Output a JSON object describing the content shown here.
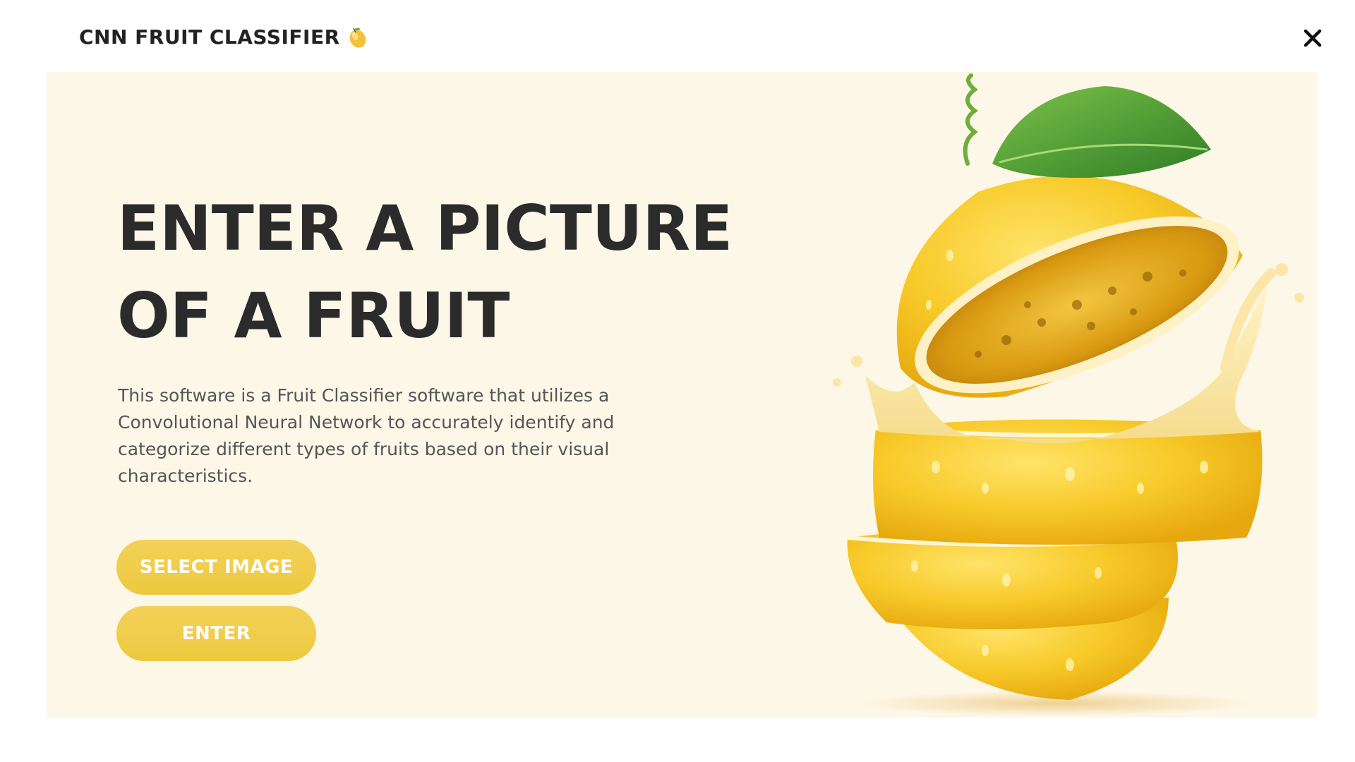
{
  "app": {
    "title": "CNN FRUIT CLASSIFIER",
    "title_icon": "mango-icon",
    "close_icon": "close-icon"
  },
  "hero": {
    "headline_line1": "ENTER A PICTURE",
    "headline_line2": "OF A FRUIT",
    "description": "This software is a Fruit Classifier software that utilizes a Convolutional Neural Network to accurately identify and categorize different types of fruits based on their visual characteristics."
  },
  "buttons": {
    "select_image": "SELECT IMAGE",
    "enter": "ENTER"
  },
  "colors": {
    "panel_background": "#fdf7e8",
    "button_yellow": "#eecb44",
    "headline": "#2b2b2b",
    "body_text": "#555555"
  },
  "image": {
    "subject": "sliced-passion-fruit-illustration"
  }
}
